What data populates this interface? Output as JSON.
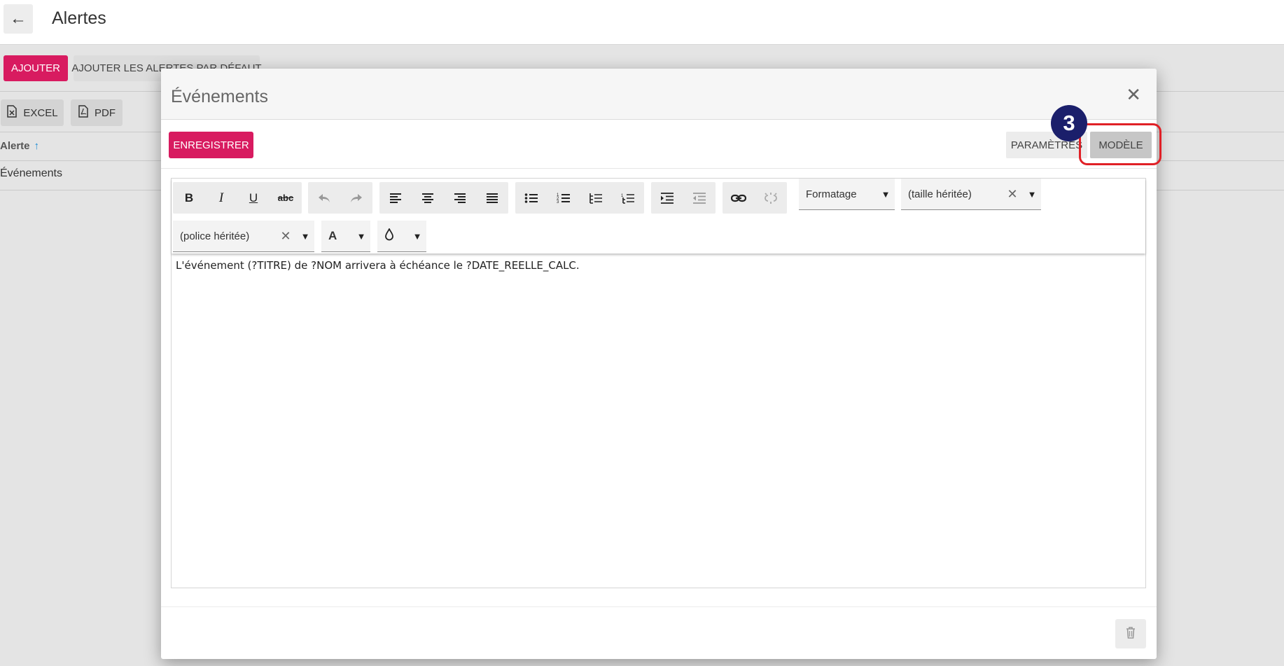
{
  "header": {
    "title": "Alertes",
    "back_icon": "arrow-left-icon"
  },
  "actions": {
    "add_label": "AJOUTER",
    "add_defaults_label": "AJOUTER LES ALERTES PAR DÉFAUT"
  },
  "exports": {
    "excel_label": "EXCEL",
    "pdf_label": "PDF"
  },
  "table": {
    "column_header": "Alerte",
    "rows": [
      "Événements"
    ]
  },
  "dialog": {
    "title": "Événements",
    "save_label": "ENREGISTRER",
    "tabs": {
      "params": "PARAMÈTRES",
      "model": "MODÈLE"
    },
    "step_number": "3",
    "toolbar": {
      "format_select": "Formatage",
      "size_select": "(taille héritée)",
      "font_select": "(police héritée)",
      "font_color_glyph": "A"
    },
    "content": "L'événement (?TITRE) de ?NOM arrivera à échéance le ?DATE_REELLE_CALC."
  },
  "colors": {
    "primary": "#d81b60",
    "highlight": "#e02026",
    "badge": "#1b1f6b",
    "sort_arrow": "#1a8ad4"
  }
}
